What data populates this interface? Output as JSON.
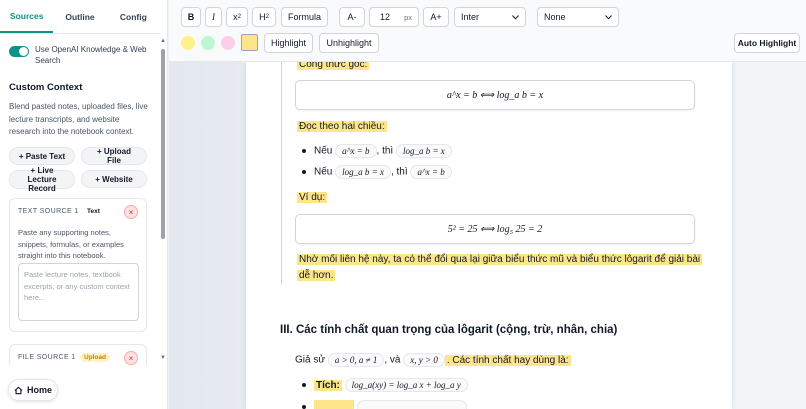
{
  "sidebar": {
    "tabs": [
      {
        "label": "Sources",
        "active": true
      },
      {
        "label": "Outline",
        "active": false
      },
      {
        "label": "Config",
        "active": false
      }
    ],
    "toggle_label": "Use OpenAI Knowledge & Web Search",
    "custom_context_heading": "Custom Context",
    "custom_context_desc": "Blend pasted notes, uploaded files, live lecture transcripts, and website research into the notebook context.",
    "buttons": {
      "paste_text": "+ Paste Text",
      "upload_file": "+ Upload File",
      "live_lecture": "+ Live Lecture Record",
      "website": "+ Website"
    },
    "source1": {
      "title": "TEXT SOURCE 1",
      "badge": "Text",
      "help": "Paste any supporting notes, snippets, formulas, or examples straight into this notebook.",
      "placeholder": "Paste lecture notes, textbook excerpts, or any custom context here..."
    },
    "source2": {
      "title": "FILE SOURCE 1",
      "badge": "Upload"
    },
    "close_glyph": "×",
    "home_label": "Home",
    "home_icon": "home-icon"
  },
  "toolbar": {
    "bold": "B",
    "italic": "I",
    "superscript_base": "x",
    "superscript_exp": "2",
    "heading_base": "H",
    "heading_sub": "2",
    "formula": "Formula",
    "font_decrease": "A-",
    "font_size": "12",
    "font_unit": "px",
    "font_increase": "A+",
    "font_family": "Inter",
    "style_select": "None",
    "highlight": "Highlight",
    "unhighlight": "Unhighlight",
    "auto_highlight": "Auto Highlight",
    "swatch_colors": [
      "#fef08a",
      "#bbf7d0",
      "#fbcfe8",
      "#fde68a"
    ]
  },
  "doc": {
    "cong_thuc_goc": "Công thức gốc:",
    "formula1": "a^x = b  ⟺  log_a b = x",
    "doc_theo": "Đọc theo hai chiều:",
    "neu": "Nếu",
    "thi": ", thì",
    "chip1": "a^x = b",
    "chip2": "log_a b = x",
    "chip3": "log_a b = x",
    "chip4": "a^x = b",
    "vi_du": "Ví dụ:",
    "formula2": "5² = 25  ⟺  log₅ 25 = 2",
    "nho_moi_1": "Nhờ mối liên hệ này, ta có thể đổi qua lại giữa biểu thức mũ và biểu thức lôgarit để giải bài",
    "nho_moi_2": "dễ hơn.",
    "section3": "III. Các tính chất quan trọng của lôgarit (cộng, trừ, nhân, chia)",
    "gia_su": "Giả sử",
    "va": ", và",
    "chip5": "a > 0, a ≠ 1",
    "chip6": "x, y > 0",
    "tinh_chat": ". Các tính chất hay dùng là:",
    "tich_label": "Tích:",
    "tich_formula": "log_a(xy) = log_a x + log_a y"
  }
}
